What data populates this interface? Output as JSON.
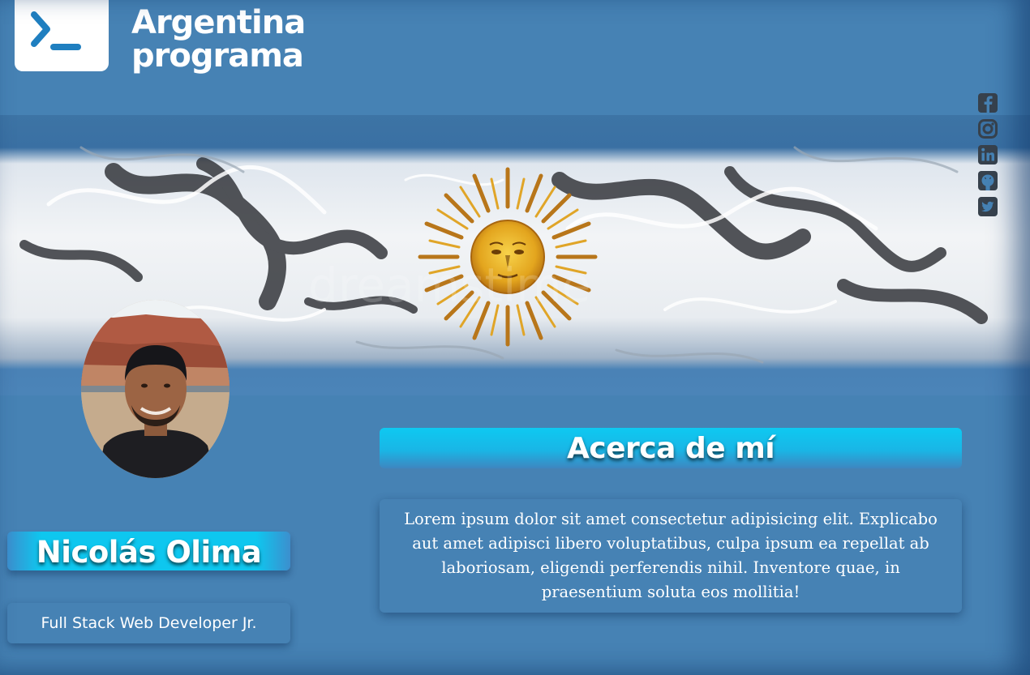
{
  "header": {
    "brand_line1": "Argentina",
    "brand_line2": "programa",
    "logo_icon": "terminal-prompt-icon"
  },
  "social": [
    {
      "name": "facebook-icon"
    },
    {
      "name": "instagram-icon"
    },
    {
      "name": "linkedin-icon"
    },
    {
      "name": "github-icon"
    },
    {
      "name": "twitter-icon"
    }
  ],
  "banner": {
    "image": "argentina-flag-sun-of-may-banner"
  },
  "profile": {
    "name": "Nicolás Olima",
    "role": "Full Stack Web Developer Jr."
  },
  "about": {
    "title": "Acerca de mí",
    "text": "Lorem ipsum dolor sit amet consectetur adipisicing elit. Explicabo aut amet adipisci libero voluptatibus, culpa ipsum ea repellat ab laboriosam, eligendi perferendis nihil. Inventore quae, in praesentium soluta eos mollitia!"
  },
  "colors": {
    "background": "#4682b4",
    "accent": "#0ec7ef",
    "sun": "#e3a51e"
  }
}
